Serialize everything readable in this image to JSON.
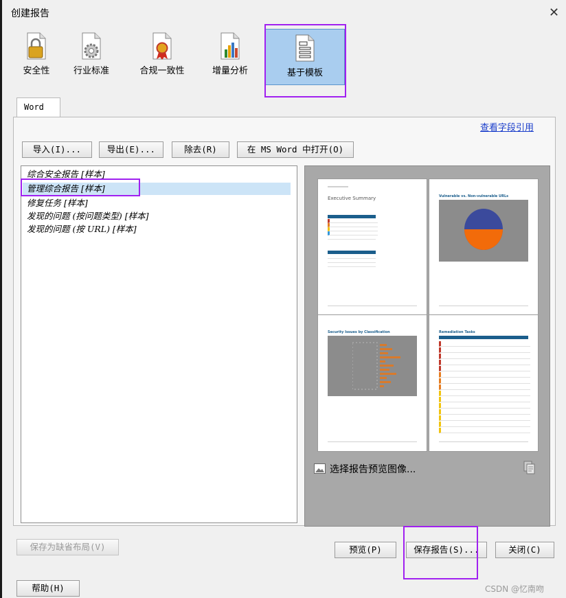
{
  "window": {
    "title": "创建报告",
    "close_glyph": "✕"
  },
  "toolbar": {
    "items": [
      {
        "label": "安全性",
        "icon": "lock-document-icon"
      },
      {
        "label": "行业标准",
        "icon": "gear-document-icon"
      },
      {
        "label": "合规一致性",
        "icon": "award-document-icon"
      },
      {
        "label": "增量分析",
        "icon": "chart-document-icon"
      },
      {
        "label": "基于模板",
        "icon": "template-document-icon",
        "selected": true
      }
    ]
  },
  "tab": {
    "label": "Word"
  },
  "link": {
    "view_field_refs": "查看字段引用"
  },
  "actions": {
    "import": "导入(I)...",
    "export": "导出(E)...",
    "remove": "除去(R)",
    "open_in_word": "在 MS Word 中打开(O)"
  },
  "templates": [
    "综合安全报告 [样本]",
    "管理综合报告 [样本]",
    "修复任务 [样本]",
    "发现的问题 (按问题类型) [样本]",
    "发现的问题 (按 URL) [样本]"
  ],
  "selected_template_index": 1,
  "preview": {
    "caption": "选择报告预览图像...",
    "pages": [
      {
        "heading": "Executive Summary"
      },
      {
        "heading": "Vulnerable vs. Non-vulnerable URLs"
      },
      {
        "heading": "Security Issues by Classification"
      },
      {
        "heading": "Remediation Tasks"
      }
    ]
  },
  "footer": {
    "save_default_layout": "保存为缺省布局(V)",
    "preview": "预览(P)",
    "save_report": "保存报告(S)...",
    "close": "关闭(C)",
    "help": "帮助(H)"
  },
  "watermark": "CSDN @忆南吻",
  "colors": {
    "highlight": "#a020f0",
    "selected_bg": "#a9cdef",
    "link": "#1a3ecb"
  }
}
